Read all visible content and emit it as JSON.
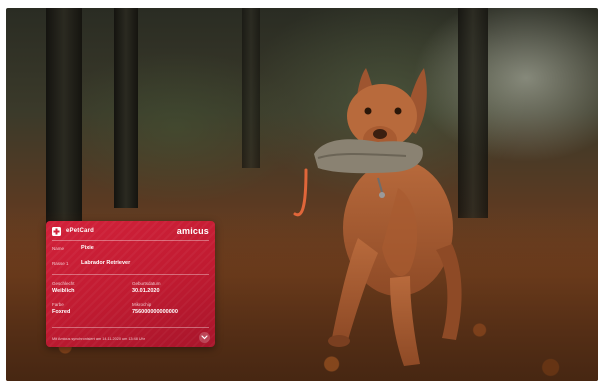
{
  "card": {
    "title": "ePetCard",
    "brand": "amicus",
    "name_label": "Name",
    "name_value": "Pixie",
    "breed_label": "Rasse 1",
    "breed_value": "Labrador Retriever",
    "sex_label": "Geschlecht",
    "sex_value": "Weiblich",
    "birth_label": "Geburtsdatum",
    "birth_value": "30.01.2020",
    "color_label": "Farbe",
    "color_value": "Foxred",
    "chip_label": "Mikrochip",
    "chip_value": "756000000000000",
    "footer": "Mit Amicus synchronisiert am 14.11.2020 um 13:48 Uhr"
  },
  "colors": {
    "card_red": "#c01b31",
    "text": "#ffffff"
  },
  "icons": {
    "logo": "swiss-cross-icon",
    "expand": "chevron-down-icon"
  }
}
